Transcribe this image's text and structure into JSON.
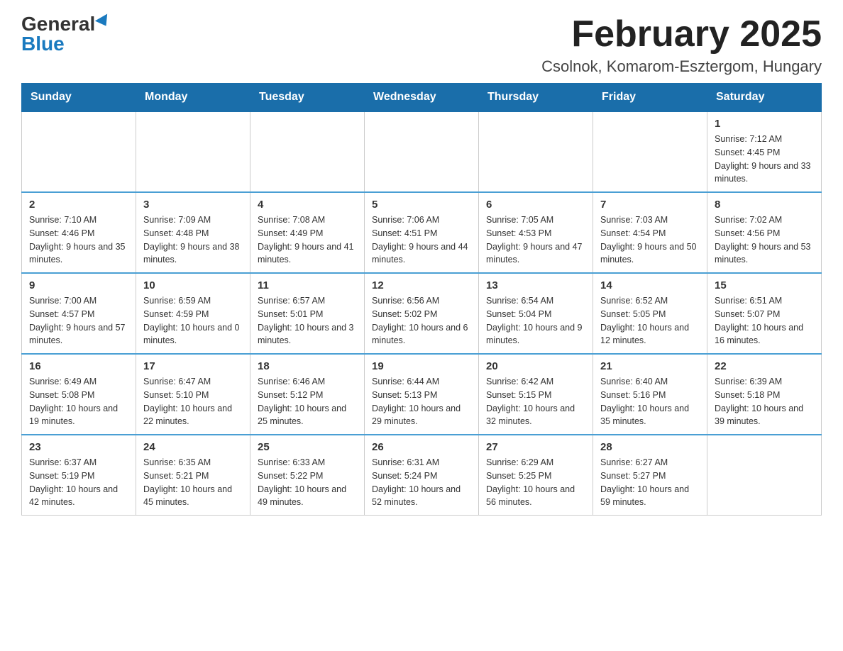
{
  "logo": {
    "general": "General",
    "blue": "Blue"
  },
  "header": {
    "title": "February 2025",
    "subtitle": "Csolnok, Komarom-Esztergom, Hungary"
  },
  "days_of_week": [
    "Sunday",
    "Monday",
    "Tuesday",
    "Wednesday",
    "Thursday",
    "Friday",
    "Saturday"
  ],
  "weeks": [
    {
      "days": [
        {
          "num": "",
          "empty": true
        },
        {
          "num": "",
          "empty": true
        },
        {
          "num": "",
          "empty": true
        },
        {
          "num": "",
          "empty": true
        },
        {
          "num": "",
          "empty": true
        },
        {
          "num": "",
          "empty": true
        },
        {
          "num": "1",
          "sunrise": "7:12 AM",
          "sunset": "4:45 PM",
          "daylight": "9 hours and 33 minutes"
        }
      ]
    },
    {
      "days": [
        {
          "num": "2",
          "sunrise": "7:10 AM",
          "sunset": "4:46 PM",
          "daylight": "9 hours and 35 minutes"
        },
        {
          "num": "3",
          "sunrise": "7:09 AM",
          "sunset": "4:48 PM",
          "daylight": "9 hours and 38 minutes"
        },
        {
          "num": "4",
          "sunrise": "7:08 AM",
          "sunset": "4:49 PM",
          "daylight": "9 hours and 41 minutes"
        },
        {
          "num": "5",
          "sunrise": "7:06 AM",
          "sunset": "4:51 PM",
          "daylight": "9 hours and 44 minutes"
        },
        {
          "num": "6",
          "sunrise": "7:05 AM",
          "sunset": "4:53 PM",
          "daylight": "9 hours and 47 minutes"
        },
        {
          "num": "7",
          "sunrise": "7:03 AM",
          "sunset": "4:54 PM",
          "daylight": "9 hours and 50 minutes"
        },
        {
          "num": "8",
          "sunrise": "7:02 AM",
          "sunset": "4:56 PM",
          "daylight": "9 hours and 53 minutes"
        }
      ]
    },
    {
      "days": [
        {
          "num": "9",
          "sunrise": "7:00 AM",
          "sunset": "4:57 PM",
          "daylight": "9 hours and 57 minutes"
        },
        {
          "num": "10",
          "sunrise": "6:59 AM",
          "sunset": "4:59 PM",
          "daylight": "10 hours and 0 minutes"
        },
        {
          "num": "11",
          "sunrise": "6:57 AM",
          "sunset": "5:01 PM",
          "daylight": "10 hours and 3 minutes"
        },
        {
          "num": "12",
          "sunrise": "6:56 AM",
          "sunset": "5:02 PM",
          "daylight": "10 hours and 6 minutes"
        },
        {
          "num": "13",
          "sunrise": "6:54 AM",
          "sunset": "5:04 PM",
          "daylight": "10 hours and 9 minutes"
        },
        {
          "num": "14",
          "sunrise": "6:52 AM",
          "sunset": "5:05 PM",
          "daylight": "10 hours and 12 minutes"
        },
        {
          "num": "15",
          "sunrise": "6:51 AM",
          "sunset": "5:07 PM",
          "daylight": "10 hours and 16 minutes"
        }
      ]
    },
    {
      "days": [
        {
          "num": "16",
          "sunrise": "6:49 AM",
          "sunset": "5:08 PM",
          "daylight": "10 hours and 19 minutes"
        },
        {
          "num": "17",
          "sunrise": "6:47 AM",
          "sunset": "5:10 PM",
          "daylight": "10 hours and 22 minutes"
        },
        {
          "num": "18",
          "sunrise": "6:46 AM",
          "sunset": "5:12 PM",
          "daylight": "10 hours and 25 minutes"
        },
        {
          "num": "19",
          "sunrise": "6:44 AM",
          "sunset": "5:13 PM",
          "daylight": "10 hours and 29 minutes"
        },
        {
          "num": "20",
          "sunrise": "6:42 AM",
          "sunset": "5:15 PM",
          "daylight": "10 hours and 32 minutes"
        },
        {
          "num": "21",
          "sunrise": "6:40 AM",
          "sunset": "5:16 PM",
          "daylight": "10 hours and 35 minutes"
        },
        {
          "num": "22",
          "sunrise": "6:39 AM",
          "sunset": "5:18 PM",
          "daylight": "10 hours and 39 minutes"
        }
      ]
    },
    {
      "days": [
        {
          "num": "23",
          "sunrise": "6:37 AM",
          "sunset": "5:19 PM",
          "daylight": "10 hours and 42 minutes"
        },
        {
          "num": "24",
          "sunrise": "6:35 AM",
          "sunset": "5:21 PM",
          "daylight": "10 hours and 45 minutes"
        },
        {
          "num": "25",
          "sunrise": "6:33 AM",
          "sunset": "5:22 PM",
          "daylight": "10 hours and 49 minutes"
        },
        {
          "num": "26",
          "sunrise": "6:31 AM",
          "sunset": "5:24 PM",
          "daylight": "10 hours and 52 minutes"
        },
        {
          "num": "27",
          "sunrise": "6:29 AM",
          "sunset": "5:25 PM",
          "daylight": "10 hours and 56 minutes"
        },
        {
          "num": "28",
          "sunrise": "6:27 AM",
          "sunset": "5:27 PM",
          "daylight": "10 hours and 59 minutes"
        },
        {
          "num": "",
          "empty": true
        }
      ]
    }
  ]
}
